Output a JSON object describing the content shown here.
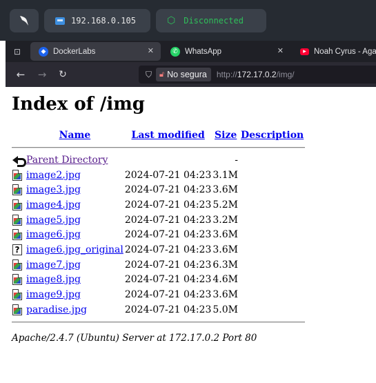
{
  "system_bar": {
    "ip_address": "192.168.0.105",
    "vpn_status": "Disconnected",
    "vpn_status_color": "#2fbf5a"
  },
  "browser": {
    "tabs": [
      {
        "title": "DockerLabs",
        "favicon": "docker-icon",
        "active": true
      },
      {
        "title": "WhatsApp",
        "favicon": "whatsapp-icon",
        "active": false
      },
      {
        "title": "Noah Cyrus - Aga",
        "favicon": "youtube-icon",
        "active": false
      }
    ],
    "security_label": "No segura",
    "url_protocol": "http://",
    "url_host": "172.17.0.2",
    "url_path": "/img/"
  },
  "page": {
    "title": "Index of /img",
    "columns": {
      "name": "Name",
      "last_modified": "Last modified",
      "size": "Size",
      "description": "Description"
    },
    "parent": {
      "name": "Parent Directory",
      "size": "-"
    },
    "files": [
      {
        "name": "image2.jpg",
        "modified": "2024-07-21 04:23",
        "size": "3.1M",
        "icon": "image-file-icon"
      },
      {
        "name": "image3.jpg",
        "modified": "2024-07-21 04:23",
        "size": "3.6M",
        "icon": "image-file-icon"
      },
      {
        "name": "image4.jpg",
        "modified": "2024-07-21 04:23",
        "size": "5.2M",
        "icon": "image-file-icon"
      },
      {
        "name": "image5.jpg",
        "modified": "2024-07-21 04:23",
        "size": "3.2M",
        "icon": "image-file-icon"
      },
      {
        "name": "image6.jpg",
        "modified": "2024-07-21 04:23",
        "size": "3.6M",
        "icon": "image-file-icon"
      },
      {
        "name": "image6.jpg_original",
        "modified": "2024-07-21 04:23",
        "size": "3.6M",
        "icon": "unknown-file-icon"
      },
      {
        "name": "image7.jpg",
        "modified": "2024-07-21 04:23",
        "size": "6.3M",
        "icon": "image-file-icon"
      },
      {
        "name": "image8.jpg",
        "modified": "2024-07-21 04:23",
        "size": "4.6M",
        "icon": "image-file-icon"
      },
      {
        "name": "image9.jpg",
        "modified": "2024-07-21 04:23",
        "size": "3.6M",
        "icon": "image-file-icon"
      },
      {
        "name": "paradise.jpg",
        "modified": "2024-07-21 04:23",
        "size": "5.0M",
        "icon": "image-file-icon"
      }
    ],
    "footer": "Apache/2.4.7 (Ubuntu) Server at 172.17.0.2 Port 80"
  }
}
